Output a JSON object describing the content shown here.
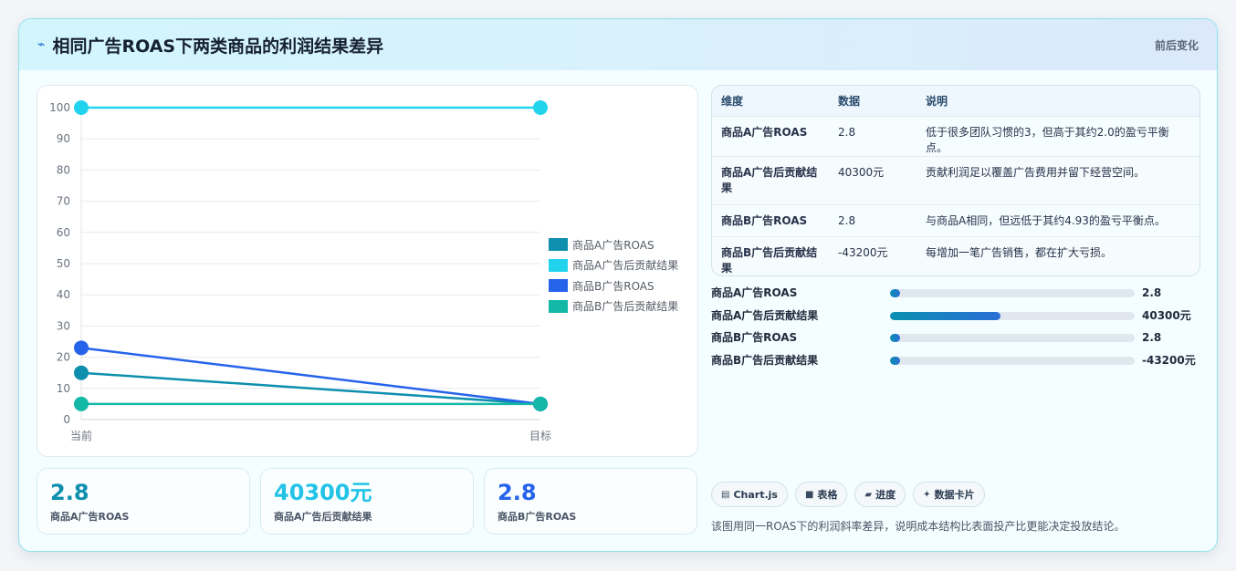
{
  "header": {
    "title": "相同广告ROAS下两类商品的利润结果差异",
    "right_label": "前后变化"
  },
  "chart_data": {
    "type": "line",
    "x": [
      "当前",
      "目标"
    ],
    "ylim": [
      0,
      100
    ],
    "yticks": [
      0,
      10,
      20,
      30,
      40,
      50,
      60,
      70,
      80,
      90,
      100
    ],
    "series": [
      {
        "name": "商品A广告ROAS",
        "values": [
          15,
          5
        ],
        "color": "#0e8fae"
      },
      {
        "name": "商品A广告后贡献结果",
        "values": [
          100,
          100
        ],
        "color": "#22d3ee"
      },
      {
        "name": "商品B广告ROAS",
        "values": [
          23,
          5
        ],
        "color": "#2563eb"
      },
      {
        "name": "商品B广告后贡献结果",
        "values": [
          5,
          5
        ],
        "color": "#14b8a6"
      }
    ]
  },
  "metrics": [
    {
      "value": "2.8",
      "label": "商品A广告ROAS",
      "color": "#0e8fae"
    },
    {
      "value": "40300元",
      "label": "商品A广告后贡献结果",
      "color": "#22c3e6"
    },
    {
      "value": "2.8",
      "label": "商品B广告ROAS",
      "color": "#2563eb"
    }
  ],
  "table": {
    "headers": [
      "维度",
      "数据",
      "说明"
    ],
    "rows": [
      {
        "dim": "商品A广告ROAS",
        "val": "2.8",
        "desc": "低于很多团队习惯的3，但高于其约2.0的盈亏平衡点。"
      },
      {
        "dim": "商品A广告后贡献结果",
        "val": "40300元",
        "desc": "贡献利润足以覆盖广告费用并留下经营空间。"
      },
      {
        "dim": "商品B广告ROAS",
        "val": "2.8",
        "desc": "与商品A相同，但远低于其约4.93的盈亏平衡点。"
      },
      {
        "dim": "商品B广告后贡献结果",
        "val": "-43200元",
        "desc": "每增加一笔广告销售，都在扩大亏损。"
      }
    ]
  },
  "progress": [
    {
      "label": "商品A广告ROAS",
      "value": "2.8",
      "fraction": 0.04
    },
    {
      "label": "商品A广告后贡献结果",
      "value": "40300元",
      "fraction": 0.45
    },
    {
      "label": "商品B广告ROAS",
      "value": "2.8",
      "fraction": 0.04
    },
    {
      "label": "商品B广告后贡献结果",
      "value": "-43200元",
      "fraction": 0.04
    }
  ],
  "tags": [
    {
      "icon": "chart-icon",
      "glyph": "▤",
      "label": "Chart.js"
    },
    {
      "icon": "table-icon",
      "glyph": "■",
      "label": "表格"
    },
    {
      "icon": "progress-icon",
      "glyph": "▰",
      "label": "进度"
    },
    {
      "icon": "sparkle-icon",
      "glyph": "✦",
      "label": "数据卡片"
    }
  ],
  "note": "该图用同一ROAS下的利润斜率差异，说明成本结构比表面投产比更能决定投放结论。"
}
